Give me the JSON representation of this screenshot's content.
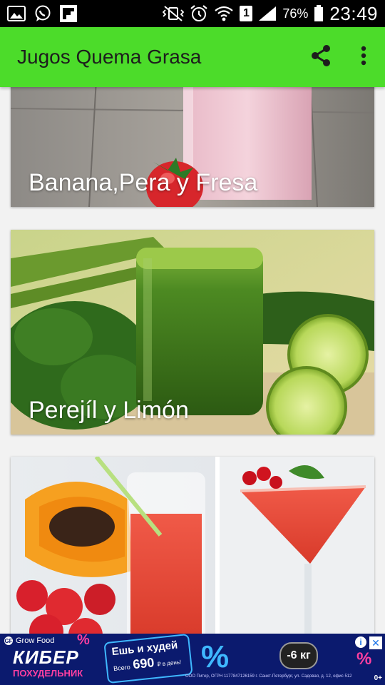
{
  "status_bar": {
    "left_icons": [
      "image-icon",
      "whatsapp-icon",
      "flipboard-icon"
    ],
    "right_icons": [
      "mute-vibrate-icon",
      "alarm-icon",
      "wifi-icon",
      "sim-1-icon",
      "signal-icon",
      "battery-icon"
    ],
    "sim_label": "1",
    "battery": "76%",
    "time": "23:49"
  },
  "app_bar": {
    "title": "Jugos Quema Grasa",
    "actions": [
      "share-icon",
      "more-vert-icon"
    ],
    "color": "#4cdc2a"
  },
  "cards": [
    {
      "title": "Banana,Pera y Fresa",
      "image": "strawberry-smoothie-photo"
    },
    {
      "title": "Perejíl y Limón",
      "image": "green-juice-lime-photo"
    },
    {
      "title": "",
      "image": "papaya-juice-cocktail-photo"
    }
  ],
  "ad": {
    "brand": "Grow Food",
    "headline": "КИБЕР",
    "subheadline": "ПОХУДЕЛЬНИК",
    "slogan": "Ешь и худей",
    "price_prefix": "Всего",
    "price": "690",
    "price_unit": "₽ в день!",
    "badge": "-6 кг",
    "fine_print": "ООО Питер, ОГРН 1177847126159 г. Санкт-Петербург, ул. Садовая, д. 12, офис 512",
    "age_rating": "0+",
    "info_icon": "i",
    "close_icon": "✕"
  }
}
